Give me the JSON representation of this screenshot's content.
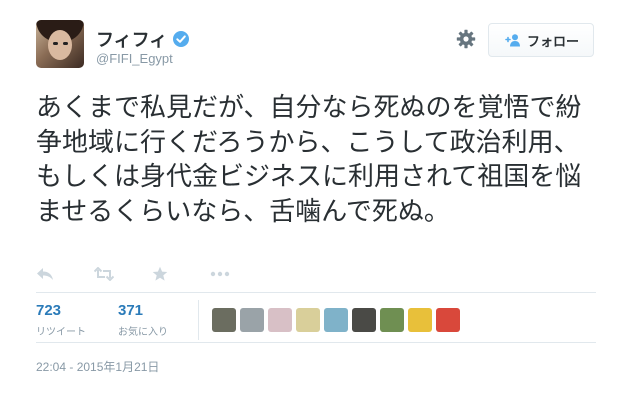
{
  "user": {
    "name": "フィフィ",
    "handle": "@FIFI_Egypt",
    "verified": true
  },
  "follow_button": {
    "label": "フォロー",
    "icon": "add-user-icon"
  },
  "tweet": {
    "text": "あくまで私見だが、自分なら死ぬのを覚悟で紛争地域に行くだろうから、こうして政治利用、もしくは身代金ビジネスに利用されて祖国を悩ませるくらいなら、舌噛んで死ぬ。",
    "timestamp": "22:04 - 2015年1月21日"
  },
  "actions": [
    "reply-icon",
    "retweet-icon",
    "favorite-icon",
    "more-icon"
  ],
  "stats": {
    "retweets": {
      "count": "723",
      "label": "リツイート"
    },
    "favorites": {
      "count": "371",
      "label": "お気に入り"
    }
  },
  "favoriter_avatars": [
    {
      "name": "favoriter-avatar-1",
      "color": "#6b6d60"
    },
    {
      "name": "favoriter-avatar-2",
      "color": "#9aa3a8"
    },
    {
      "name": "favoriter-avatar-3",
      "color": "#d8c0c6"
    },
    {
      "name": "favoriter-avatar-4",
      "color": "#d9cf9a"
    },
    {
      "name": "favoriter-avatar-5",
      "color": "#7fb2c9"
    },
    {
      "name": "favoriter-avatar-6",
      "color": "#4a4a46"
    },
    {
      "name": "favoriter-avatar-7",
      "color": "#6f8f52"
    },
    {
      "name": "favoriter-avatar-8",
      "color": "#e8c03a"
    },
    {
      "name": "favoriter-avatar-9",
      "color": "#d9483b"
    }
  ],
  "colors": {
    "link": "#2b7bb9",
    "verified": "#55acee",
    "muted": "#8899a6",
    "text": "#292f33"
  }
}
